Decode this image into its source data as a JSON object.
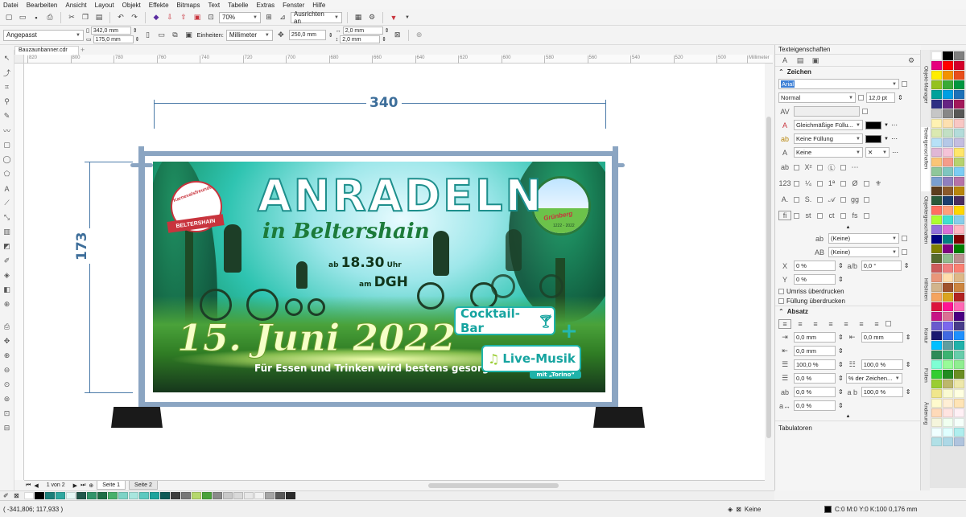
{
  "menu": [
    "Datei",
    "Bearbeiten",
    "Ansicht",
    "Layout",
    "Objekt",
    "Effekte",
    "Bitmaps",
    "Text",
    "Tabelle",
    "Extras",
    "Fenster",
    "Hilfe"
  ],
  "toolbar": {
    "zoom": "70%",
    "snap": "Ausrichten an"
  },
  "propbar": {
    "page_size": "Angepasst",
    "width": "342,0 mm",
    "height": "175,0 mm",
    "units_label": "Einheiten:",
    "units": "Millimeter",
    "nudge": "250,0 mm",
    "dup_x": "2,0 mm",
    "dup_y": "2,0 mm"
  },
  "document": {
    "tab": "Bauzaunbanner.cdr"
  },
  "ruler": {
    "units": "Millimeter",
    "ticks": [
      "820",
      "800",
      "780",
      "760",
      "740",
      "720",
      "700",
      "680",
      "660",
      "640",
      "620",
      "600",
      "580",
      "560",
      "540",
      "520",
      "500"
    ]
  },
  "dimensions": {
    "width": "340",
    "height": "173"
  },
  "banner": {
    "title": "ANRADELN",
    "subtitle": "in Beltershain",
    "time_prefix": "ab",
    "time": "18.30",
    "time_suffix": "Uhr",
    "place_prefix": "am",
    "place": "DGH",
    "date": "15. Juni 2022",
    "slogan": "Für Essen und Trinken wird bestens gesorgt!",
    "badge_cocktail": "Cocktail-Bar",
    "badge_live": "Live-Musik",
    "badge_live_sub": "mit „Torino“",
    "plus": "+",
    "logo_left_ribbon": "BELTERSHAIN",
    "logo_left_arc": "Karnevalsfreunde",
    "logo_right_text": "Grünberg",
    "logo_right_years": "1222 - 2022"
  },
  "docker": {
    "title": "Texteigenschaften",
    "section_char": "Zeichen",
    "font": "Arial",
    "style": "Normal",
    "size": "12,0 pt",
    "fill": "Gleichmäßige Füllu...",
    "bg_fill": "Keine Füllung",
    "outline": "Keine",
    "opt_a": "(Keine)",
    "opt_b": "(Keine)",
    "kern": "0 %",
    "angle": "0,0 °",
    "shift": "0 %",
    "overprint_outline": "Umriss überdrucken",
    "overprint_fill": "Füllung überdrucken",
    "section_para": "Absatz",
    "indent_left": "0,0 mm",
    "indent_first": "0,0 mm",
    "indent_right": "0,0 mm",
    "spacing_line": "100,0 %",
    "spacing_char": "100,0 %",
    "before_para": "0,0 %",
    "spacing_mode": "% der Zeichen...",
    "after_para": "0,0 %",
    "word_space": "100,0 %",
    "lang_space": "0,0 %",
    "section_tabs": "Tabulatoren"
  },
  "vtabs": [
    "Objekt-Manager",
    "Texteigenschaften",
    "Objekteigenschaften",
    "Hilfslinien",
    "Kontur",
    "Füllen",
    "Änderung"
  ],
  "pagebar": {
    "page_info": "1 von 2",
    "page1": "Seite 1",
    "page2": "Seite 2"
  },
  "status": {
    "coords": "( -341,806; 117,933 )",
    "fill": "Keine",
    "outline": "C:0 M:0 Y:0 K:100  0,176 mm"
  },
  "palette": [
    "#ffffff",
    "#000000",
    "#7f7f7f",
    "#e6007e",
    "#ff0000",
    "#d4002a",
    "#ffed00",
    "#f39200",
    "#e94e1b",
    "#95c11f",
    "#3aaa35",
    "#009640",
    "#00a19a",
    "#009fe3",
    "#1d71b8",
    "#2d2e83",
    "#662483",
    "#a3195b",
    "#c6c6c6",
    "#878787",
    "#575756",
    "#fff2b2",
    "#fde0b0",
    "#f9c7c4",
    "#dbe9b1",
    "#c2e0c4",
    "#b3dcda",
    "#b7e1f7",
    "#b5c8e7",
    "#c4bde0",
    "#e0b7d5",
    "#f5c3d8",
    "#ffe66a",
    "#fbc576",
    "#f49c8b",
    "#b7d36e",
    "#8fc79a",
    "#7fc6c0",
    "#7ccdf4",
    "#7a9fd0",
    "#8f7fbe",
    "#b673a8",
    "#5c3d1e",
    "#8a5a2b",
    "#b8860b",
    "#2a5a3a",
    "#1b3f6e",
    "#4a2d5e",
    "#ff6f61",
    "#ffa07a",
    "#ffd700",
    "#adff2f",
    "#40e0d0",
    "#87ceeb",
    "#9370db",
    "#da70d6",
    "#ffb6c1",
    "#000080",
    "#008080",
    "#800000",
    "#808000",
    "#800080",
    "#008000",
    "#556b2f",
    "#8fbc8f",
    "#bc8f8f",
    "#cd5c5c",
    "#f08080",
    "#fa8072",
    "#e9967a",
    "#ffdead",
    "#deb887",
    "#d2b48c",
    "#a0522d",
    "#cd853f",
    "#f4a460",
    "#daa520",
    "#b22222",
    "#dc143c",
    "#ff1493",
    "#ff69b4",
    "#c71585",
    "#db7093",
    "#4b0082",
    "#6a5acd",
    "#7b68ee",
    "#483d8b",
    "#191970",
    "#4169e1",
    "#1e90ff",
    "#00bfff",
    "#5f9ea0",
    "#20b2aa",
    "#2e8b57",
    "#3cb371",
    "#66cdaa",
    "#7fffd4",
    "#98fb98",
    "#90ee90",
    "#32cd32",
    "#228b22",
    "#6b8e23",
    "#9acd32",
    "#bdb76b",
    "#eee8aa",
    "#f0e68c",
    "#fafad2",
    "#ffffe0",
    "#fffacd",
    "#ffefd5",
    "#ffe4b5",
    "#ffdab9",
    "#ffe4e1",
    "#fff0f5",
    "#f5f5dc",
    "#f0fff0",
    "#f5fffa",
    "#f0ffff",
    "#e0ffff",
    "#afeeee",
    "#b0e0e6",
    "#add8e6",
    "#b0c4de"
  ],
  "docpalette": [
    "#ffffff",
    "#000000",
    "#1b7f7a",
    "#2ea8a0",
    "#e6f7f5",
    "#21574b",
    "#32946a",
    "#1f6e46",
    "#48b06b",
    "#7dd3c6",
    "#a8e6de",
    "#5cc9c0",
    "#1ea39c",
    "#0e5a56",
    "#3d3d3d",
    "#777777",
    "#b5d86c",
    "#4aa23a",
    "#8a8a8a",
    "#c9c9c9",
    "#d9d9d9",
    "#e8e8e8",
    "#f2f2f2",
    "#a6a6a6",
    "#595959",
    "#2b2b2b"
  ]
}
